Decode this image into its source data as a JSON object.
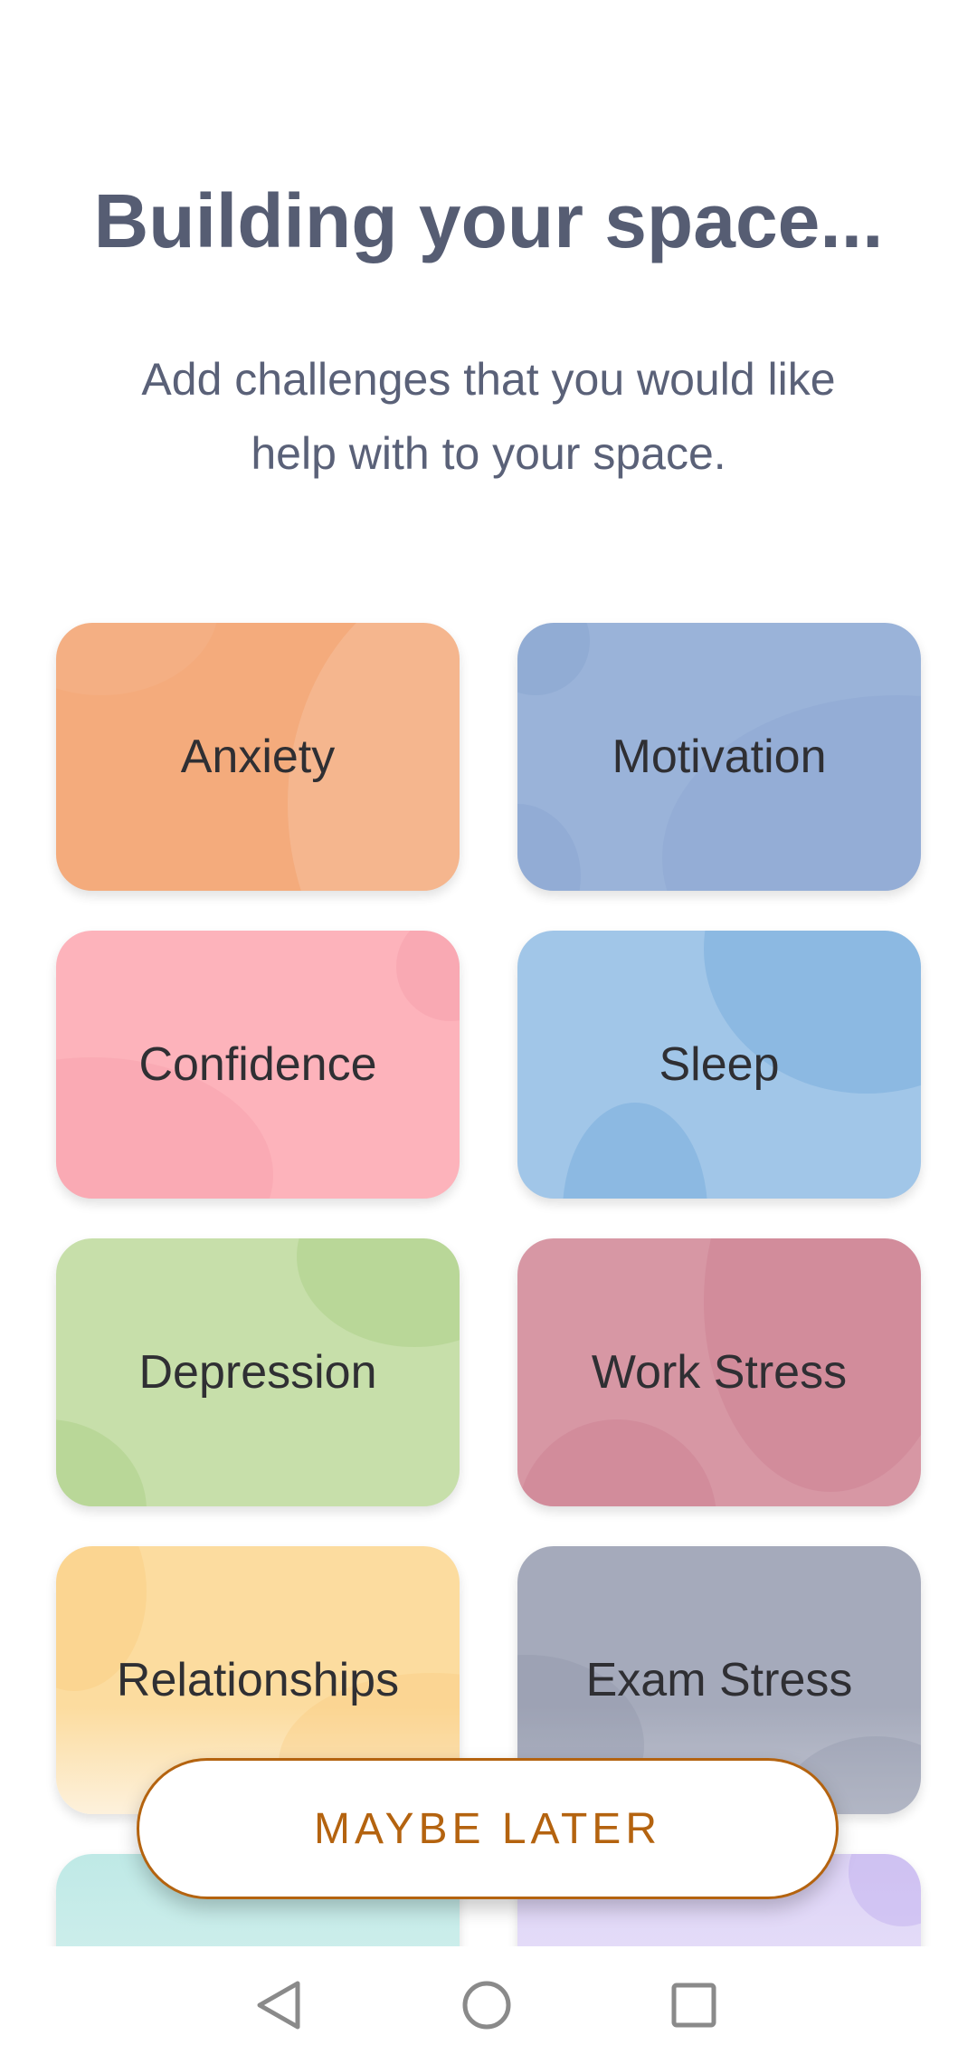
{
  "header": {
    "title": "Building your space...",
    "subtitle": "Add challenges that you would like help with to your space."
  },
  "challenges": [
    {
      "label": "Anxiety",
      "color": "#f4ab7c"
    },
    {
      "label": "Motivation",
      "color": "#9ab3d9"
    },
    {
      "label": "Confidence",
      "color": "#fdb3bb"
    },
    {
      "label": "Sleep",
      "color": "#a1c6e8"
    },
    {
      "label": "Depression",
      "color": "#c7dfaa"
    },
    {
      "label": "Work Stress",
      "color": "#d797a4"
    },
    {
      "label": "Relationships",
      "color": "#fcdc9f"
    },
    {
      "label": "Exam Stress",
      "color": "#a5aabb"
    }
  ],
  "actions": {
    "maybe_later": "MAYBE LATER"
  },
  "colors": {
    "accent": "#b4630f",
    "title": "#565d73"
  },
  "navigation": {
    "icons": [
      "back-triangle-icon",
      "home-circle-icon",
      "recents-square-icon"
    ]
  }
}
